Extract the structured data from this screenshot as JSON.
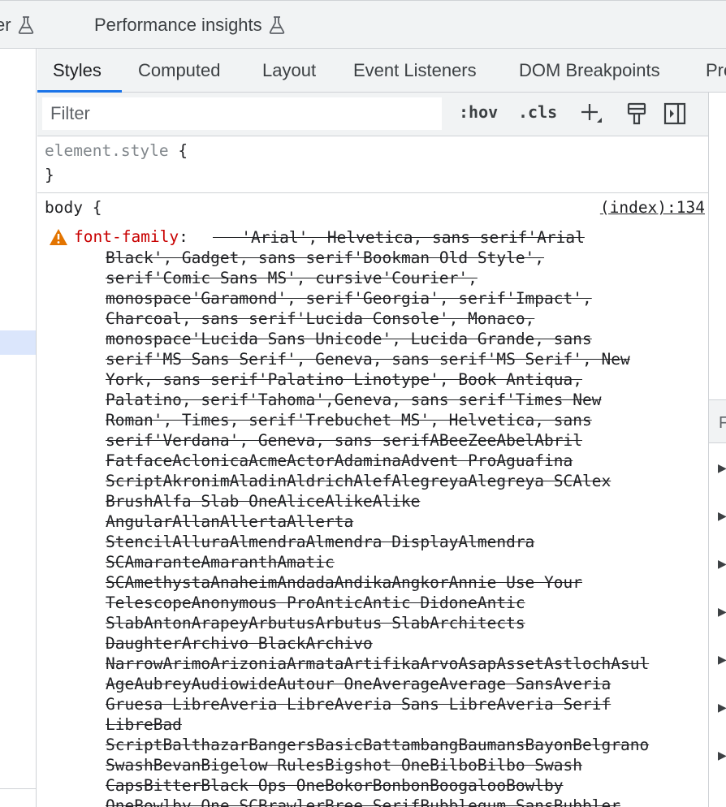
{
  "top_tabs": [
    {
      "label": "er"
    },
    {
      "label": "Performance insights"
    }
  ],
  "sub_tabs": [
    "Styles",
    "Computed",
    "Layout",
    "Event Listeners",
    "DOM Breakpoints",
    "Pro"
  ],
  "active_sub_tab": "Styles",
  "toolbar": {
    "filter_placeholder": "Filter",
    "hov_label": ":hov",
    "cls_label": ".cls",
    "icons": [
      "add-rule-icon",
      "paint-format-icon",
      "toggle-sidebar-icon"
    ]
  },
  "element_style": {
    "selector": "element.style",
    "open_brace": "{",
    "close_brace": "}"
  },
  "body_rule": {
    "selector": "body {",
    "source": "(index):134",
    "property": "font-family",
    "colon": ":",
    "warning": true,
    "value_lines": [
      "   'Arial', Helvetica, sans serif'Arial",
      "Black', Gadget, sans serif'Bookman Old Style',",
      "serif'Comic Sans MS', cursive'Courier',",
      "monospace'Garamond', serif'Georgia', serif'Impact',",
      "Charcoal, sans serif'Lucida Console', Monaco,",
      "monospace'Lucida Sans Unicode', Lucida Grande, sans",
      "serif'MS Sans Serif', Geneva, sans serif'MS Serif', New",
      "York, sans serif'Palatino Linotype', Book Antiqua,",
      "Palatino, serif'Tahoma',Geneva, sans serif'Times New",
      "Roman', Times, serif'Trebuchet MS', Helvetica, sans",
      "serif'Verdana', Geneva, sans serifABeeZeeAbelAbril",
      "FatfaceAclonicaAcmeActorAdaminaAdvent ProAguafina",
      "ScriptAkronimAladinAldrichAlefAlegreyaAlegreya SCAlex",
      "BrushAlfa Slab OneAliceAlikeAlike",
      "AngularAllanAllertaAllerta",
      "StencilAlluraAlmendraAlmendra DisplayAlmendra",
      "SCAmaranteAmaranthAmatic",
      "SCAmethystaAnaheimAndadaAndikaAngkorAnnie Use Your",
      "TelescopeAnonymous ProAnticAntic DidoneAntic",
      "SlabAntonArapeyArbutusArbutus SlabArchitects",
      "DaughterArchivo BlackArchivo",
      "NarrowArimoArizoniaArmataArtifikaArvoAsapAssetAstlochAsul",
      "AgeAubreyAudiowideAutour OneAverageAverage SansAveria",
      "Gruesa LibreAveria LibreAveria Sans LibreAveria Serif",
      "LibreBad",
      "ScriptBalthazarBangersBasicBattambangBaumansBayonBelgrano",
      "SwashBevanBigelow RulesBigshot OneBilboBilbo Swash",
      "CapsBitterBlack Ops OneBokorBonbonBoogalooBowlby",
      "OneBowlby One SCBrawlerBree SerifBubblegum SansBubbler"
    ]
  },
  "right_pane": {
    "header_label": "F",
    "collapsed_rows": 7
  },
  "colors": {
    "accent": "#1a73e8",
    "property_name": "#c80000",
    "warning": "#e37400",
    "toolbar_bg": "#f1f3f4",
    "selection_bg": "#dbe6fc"
  }
}
